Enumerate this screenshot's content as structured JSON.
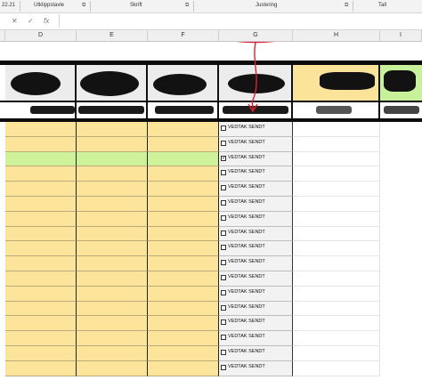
{
  "ribbon": {
    "groups": [
      "22.21",
      "Utklippstavle",
      "Skrift",
      "Justering",
      "Tall"
    ],
    "launcher_icon": "dialog-launcher-icon"
  },
  "formula_bar": {
    "cancel_icon": "✕",
    "enter_icon": "✓",
    "function_icon": "fx",
    "value": ""
  },
  "columns": [
    "D",
    "E",
    "F",
    "G",
    "H",
    "I"
  ],
  "checkbox_label": "VEDTAK SENDT",
  "rows": [
    {
      "checked": false,
      "highlight": false
    },
    {
      "checked": false,
      "highlight": false
    },
    {
      "checked": true,
      "highlight": true
    },
    {
      "checked": false,
      "highlight": false
    },
    {
      "checked": false,
      "highlight": false
    },
    {
      "checked": false,
      "highlight": false
    },
    {
      "checked": false,
      "highlight": false
    },
    {
      "checked": false,
      "highlight": false
    },
    {
      "checked": false,
      "highlight": false
    },
    {
      "checked": false,
      "highlight": false
    },
    {
      "checked": false,
      "highlight": false
    },
    {
      "checked": false,
      "highlight": false
    },
    {
      "checked": false,
      "highlight": false
    },
    {
      "checked": false,
      "highlight": false
    },
    {
      "checked": false,
      "highlight": false
    },
    {
      "checked": false,
      "highlight": false
    },
    {
      "checked": false,
      "highlight": false
    }
  ],
  "colors": {
    "yellow_fill": "#fde49b",
    "green_fill": "#cdf29a",
    "header_yellow": "#fce39a",
    "header_green": "#c8f29a",
    "annotation_red": "#e0202e",
    "grid_gray": "#f2f2f2"
  }
}
